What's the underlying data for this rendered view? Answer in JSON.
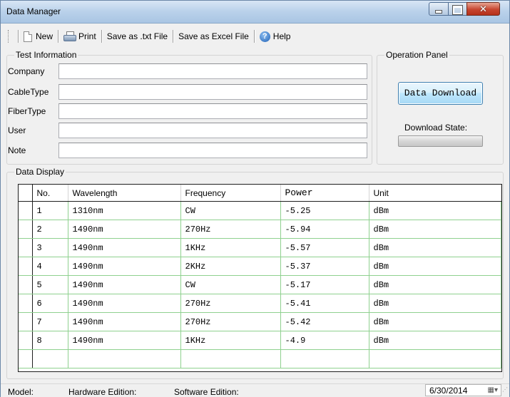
{
  "window": {
    "title": "Data Manager",
    "min_glyph": "",
    "close_glyph": "✕"
  },
  "toolbar": {
    "new_label": "New",
    "print_label": "Print",
    "save_txt_label": "Save as .txt File",
    "save_excel_label": "Save as Excel File",
    "help_label": "Help",
    "help_glyph": "?"
  },
  "test_info": {
    "legend": "Test Information",
    "fields": [
      {
        "label": "Company",
        "value": ""
      },
      {
        "label": "CableType",
        "value": ""
      },
      {
        "label": "FiberType",
        "value": ""
      },
      {
        "label": "User",
        "value": ""
      },
      {
        "label": "Note",
        "value": ""
      }
    ]
  },
  "operation": {
    "legend": "Operation Panel",
    "download_button": "Data Download",
    "download_state_label": "Download State:",
    "download_progress": 0
  },
  "data_display": {
    "legend": "Data Display",
    "columns": [
      "No.",
      "Wavelength",
      "Frequency",
      "Power",
      "Unit"
    ],
    "rows": [
      [
        "1",
        "1310nm",
        "CW",
        "-5.25",
        "dBm"
      ],
      [
        "2",
        "1490nm",
        "270Hz",
        "-5.94",
        "dBm"
      ],
      [
        "3",
        "1490nm",
        "1KHz",
        "-5.57",
        "dBm"
      ],
      [
        "4",
        "1490nm",
        "2KHz",
        "-5.37",
        "dBm"
      ],
      [
        "5",
        "1490nm",
        "CW",
        "-5.17",
        "dBm"
      ],
      [
        "6",
        "1490nm",
        "270Hz",
        "-5.41",
        "dBm"
      ],
      [
        "7",
        "1490nm",
        "270Hz",
        "-5.42",
        "dBm"
      ],
      [
        "8",
        "1490nm",
        "1KHz",
        "-4.9",
        "dBm"
      ]
    ]
  },
  "statusbar": {
    "model_label": "Model:",
    "hardware_label": "Hardware Edition:",
    "software_label": "Software Edition:",
    "date_value": "6/30/2014",
    "date_dropdown_glyph": "▦▾"
  },
  "colors": {
    "grid_line": "#8fd18f",
    "title_bar": "#b9d1ea",
    "close_button": "#c7452f"
  }
}
